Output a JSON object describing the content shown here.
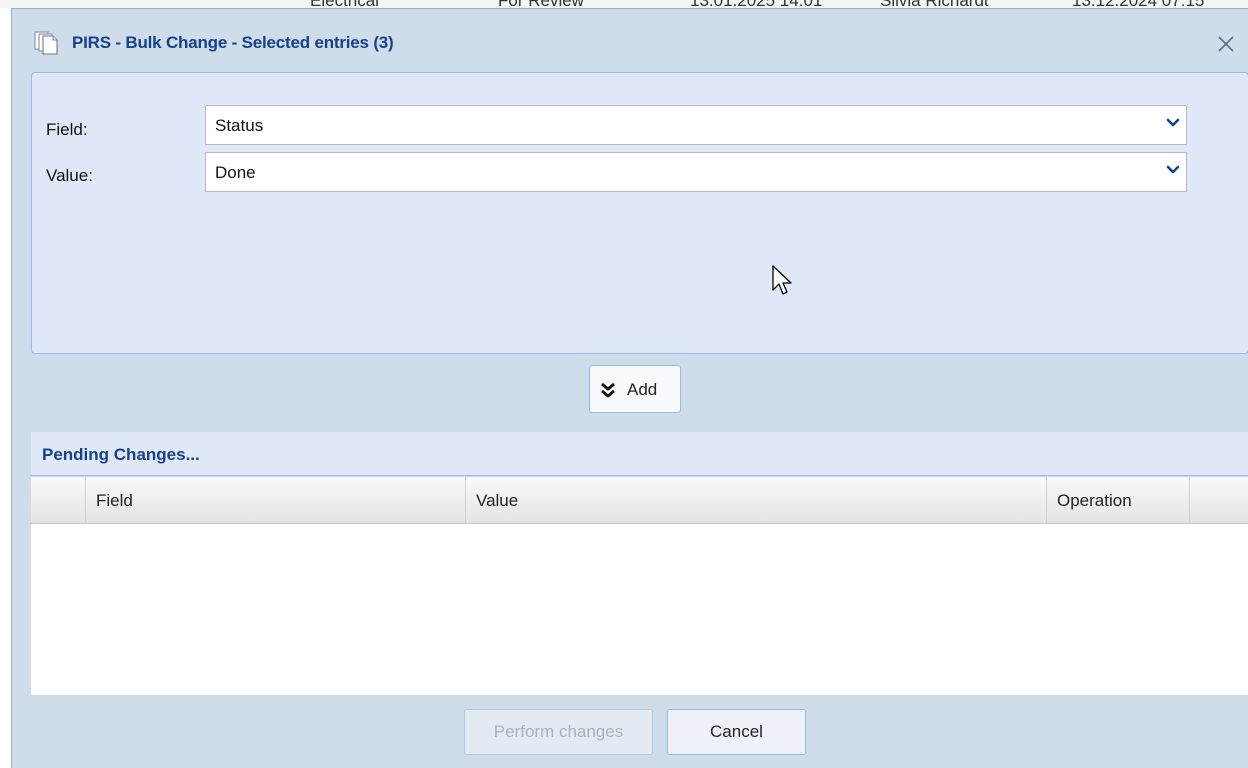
{
  "background_row": {
    "cells": [
      "Electrical",
      "For Review",
      "13.01.2025 14:01",
      "Silvia Richardt",
      "13.12.2024 07:15"
    ]
  },
  "dialog": {
    "title": "PIRS - Bulk Change - Selected entries (3)",
    "icon": "documents-icon",
    "close_icon": "close-icon"
  },
  "form": {
    "field_label": "Field:",
    "field_value": "Status",
    "value_label": "Value:",
    "value_value": "Done"
  },
  "add_button": {
    "label": "Add",
    "icon": "double-chevron-down-icon"
  },
  "pending": {
    "title": "Pending Changes...",
    "columns": [
      "",
      "Field",
      "Value",
      "Operation",
      ""
    ],
    "rows": []
  },
  "footer": {
    "perform_label": "Perform changes",
    "cancel_label": "Cancel"
  },
  "colors": {
    "accent": "#15428b",
    "dialog_bg": "#cfdcea",
    "panel_bg": "#dfe8f6",
    "border": "#99bbe8"
  }
}
